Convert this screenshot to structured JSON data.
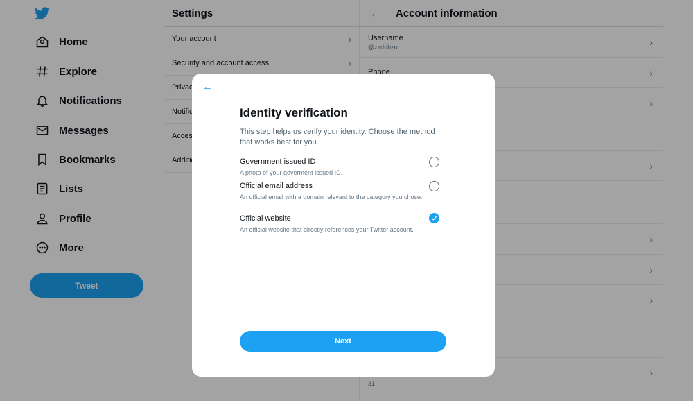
{
  "nav": {
    "items": [
      {
        "label": "Home",
        "icon": "home-icon"
      },
      {
        "label": "Explore",
        "icon": "hashtag-icon"
      },
      {
        "label": "Notifications",
        "icon": "bell-icon"
      },
      {
        "label": "Messages",
        "icon": "envelope-icon"
      },
      {
        "label": "Bookmarks",
        "icon": "bookmark-icon"
      },
      {
        "label": "Lists",
        "icon": "list-icon"
      },
      {
        "label": "Profile",
        "icon": "person-icon"
      },
      {
        "label": "More",
        "icon": "more-icon"
      }
    ],
    "tweet_label": "Tweet"
  },
  "settings": {
    "title": "Settings",
    "items": [
      {
        "label": "Your account"
      },
      {
        "label": "Security and account access"
      },
      {
        "label": "Privacy and safety"
      },
      {
        "label": "Notifications"
      },
      {
        "label": "Accessibility, display and languages"
      },
      {
        "label": "Additional resources"
      }
    ]
  },
  "account": {
    "title": "Account information",
    "rows": [
      {
        "label": "Username",
        "value": "@zzdubzo"
      },
      {
        "label": "Phone",
        "value": ""
      },
      {
        "label": "",
        "value": ""
      },
      {
        "label": "",
        "value": ""
      },
      {
        "label": "",
        "value": ""
      },
      {
        "label": "",
        "value": ""
      },
      {
        "label": "",
        "value": ""
      },
      {
        "label": "",
        "value": ""
      },
      {
        "label": "",
        "value": ""
      },
      {
        "label": "",
        "value": ""
      },
      {
        "label": "",
        "value": "31"
      }
    ]
  },
  "modal": {
    "title": "Identity verification",
    "description": "This step helps us verify your identity. Choose the method that works best for you.",
    "options": [
      {
        "title": "Government issued ID",
        "description": "A photo of your goverment issued ID.",
        "selected": false
      },
      {
        "title": "Official email address",
        "description": "An official email with a domain relevant to the category you chose.",
        "selected": false
      },
      {
        "title": "Official website",
        "description": "An official website that directly references your Twitter account.",
        "selected": true
      }
    ],
    "next_label": "Next"
  },
  "colors": {
    "accent": "#1da1f2",
    "overlay": "rgba(0,0,0,0.36)"
  }
}
